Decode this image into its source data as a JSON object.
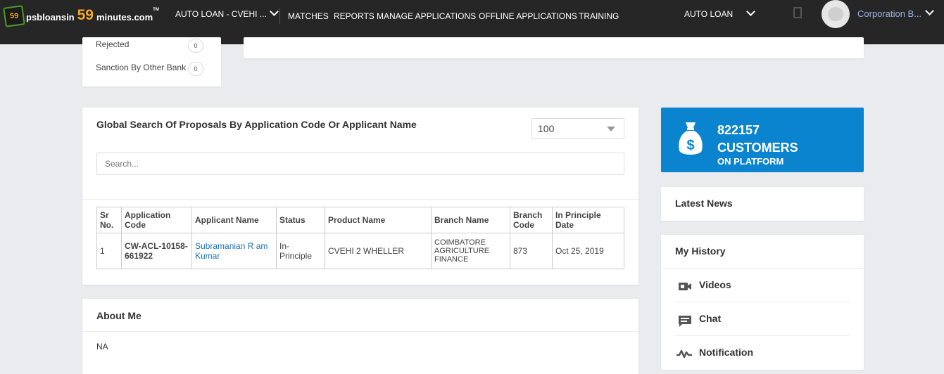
{
  "brand": {
    "logo_badge": "59",
    "prefix": "psbloansin",
    "number": "59",
    "suffix": "minutes.com",
    "tm": "TM"
  },
  "nav": {
    "loan_dropdown": "AUTO LOAN - CVEHI ...",
    "items": [
      "MATCHES",
      "REPORTS",
      "MANAGE APPLICATIONS",
      "OFFLINE APPLICATIONS",
      "TRAINING"
    ],
    "right_dropdown": "AUTO LOAN",
    "user_name": "Corporation B..."
  },
  "status_list": [
    {
      "label": "Rejected",
      "count": "0"
    },
    {
      "label": "Sanction By Other Bank",
      "count": "0"
    }
  ],
  "search": {
    "title": "Global Search Of Proposals By Application Code Or Applicant Name",
    "page_size": "100",
    "placeholder": "Search..."
  },
  "table": {
    "headers": [
      "Sr No.",
      "Application Code",
      "Applicant Name",
      "Status",
      "Product Name",
      "Branch Name",
      "Branch Code",
      "In Principle Date"
    ],
    "rows": [
      [
        "1",
        "CW-ACL-10158-661922",
        "Subramanian R am Kumar",
        "In-Principle",
        "CVEHI 2 WHELLER",
        "COIMBATORE AGRICULTURE FINANCE",
        "873",
        "Oct 25, 2019"
      ]
    ]
  },
  "about": {
    "title": "About Me",
    "value": "NA"
  },
  "customers": {
    "count": "822157",
    "label": "CUSTOMERS",
    "sub": "ON PLATFORM"
  },
  "news": {
    "title": "Latest News"
  },
  "history": {
    "title": "My History",
    "items": [
      {
        "label": "Videos",
        "icon": "video-camera-icon"
      },
      {
        "label": "Chat",
        "icon": "chat-icon"
      },
      {
        "label": "Notification",
        "icon": "activity-icon"
      }
    ]
  },
  "colors": {
    "nav_bg": "#262626",
    "accent_blue": "#0b84cf",
    "logo_orange": "#f5a623",
    "link": "#1a73b8",
    "user_name": "#9ab3e6"
  }
}
